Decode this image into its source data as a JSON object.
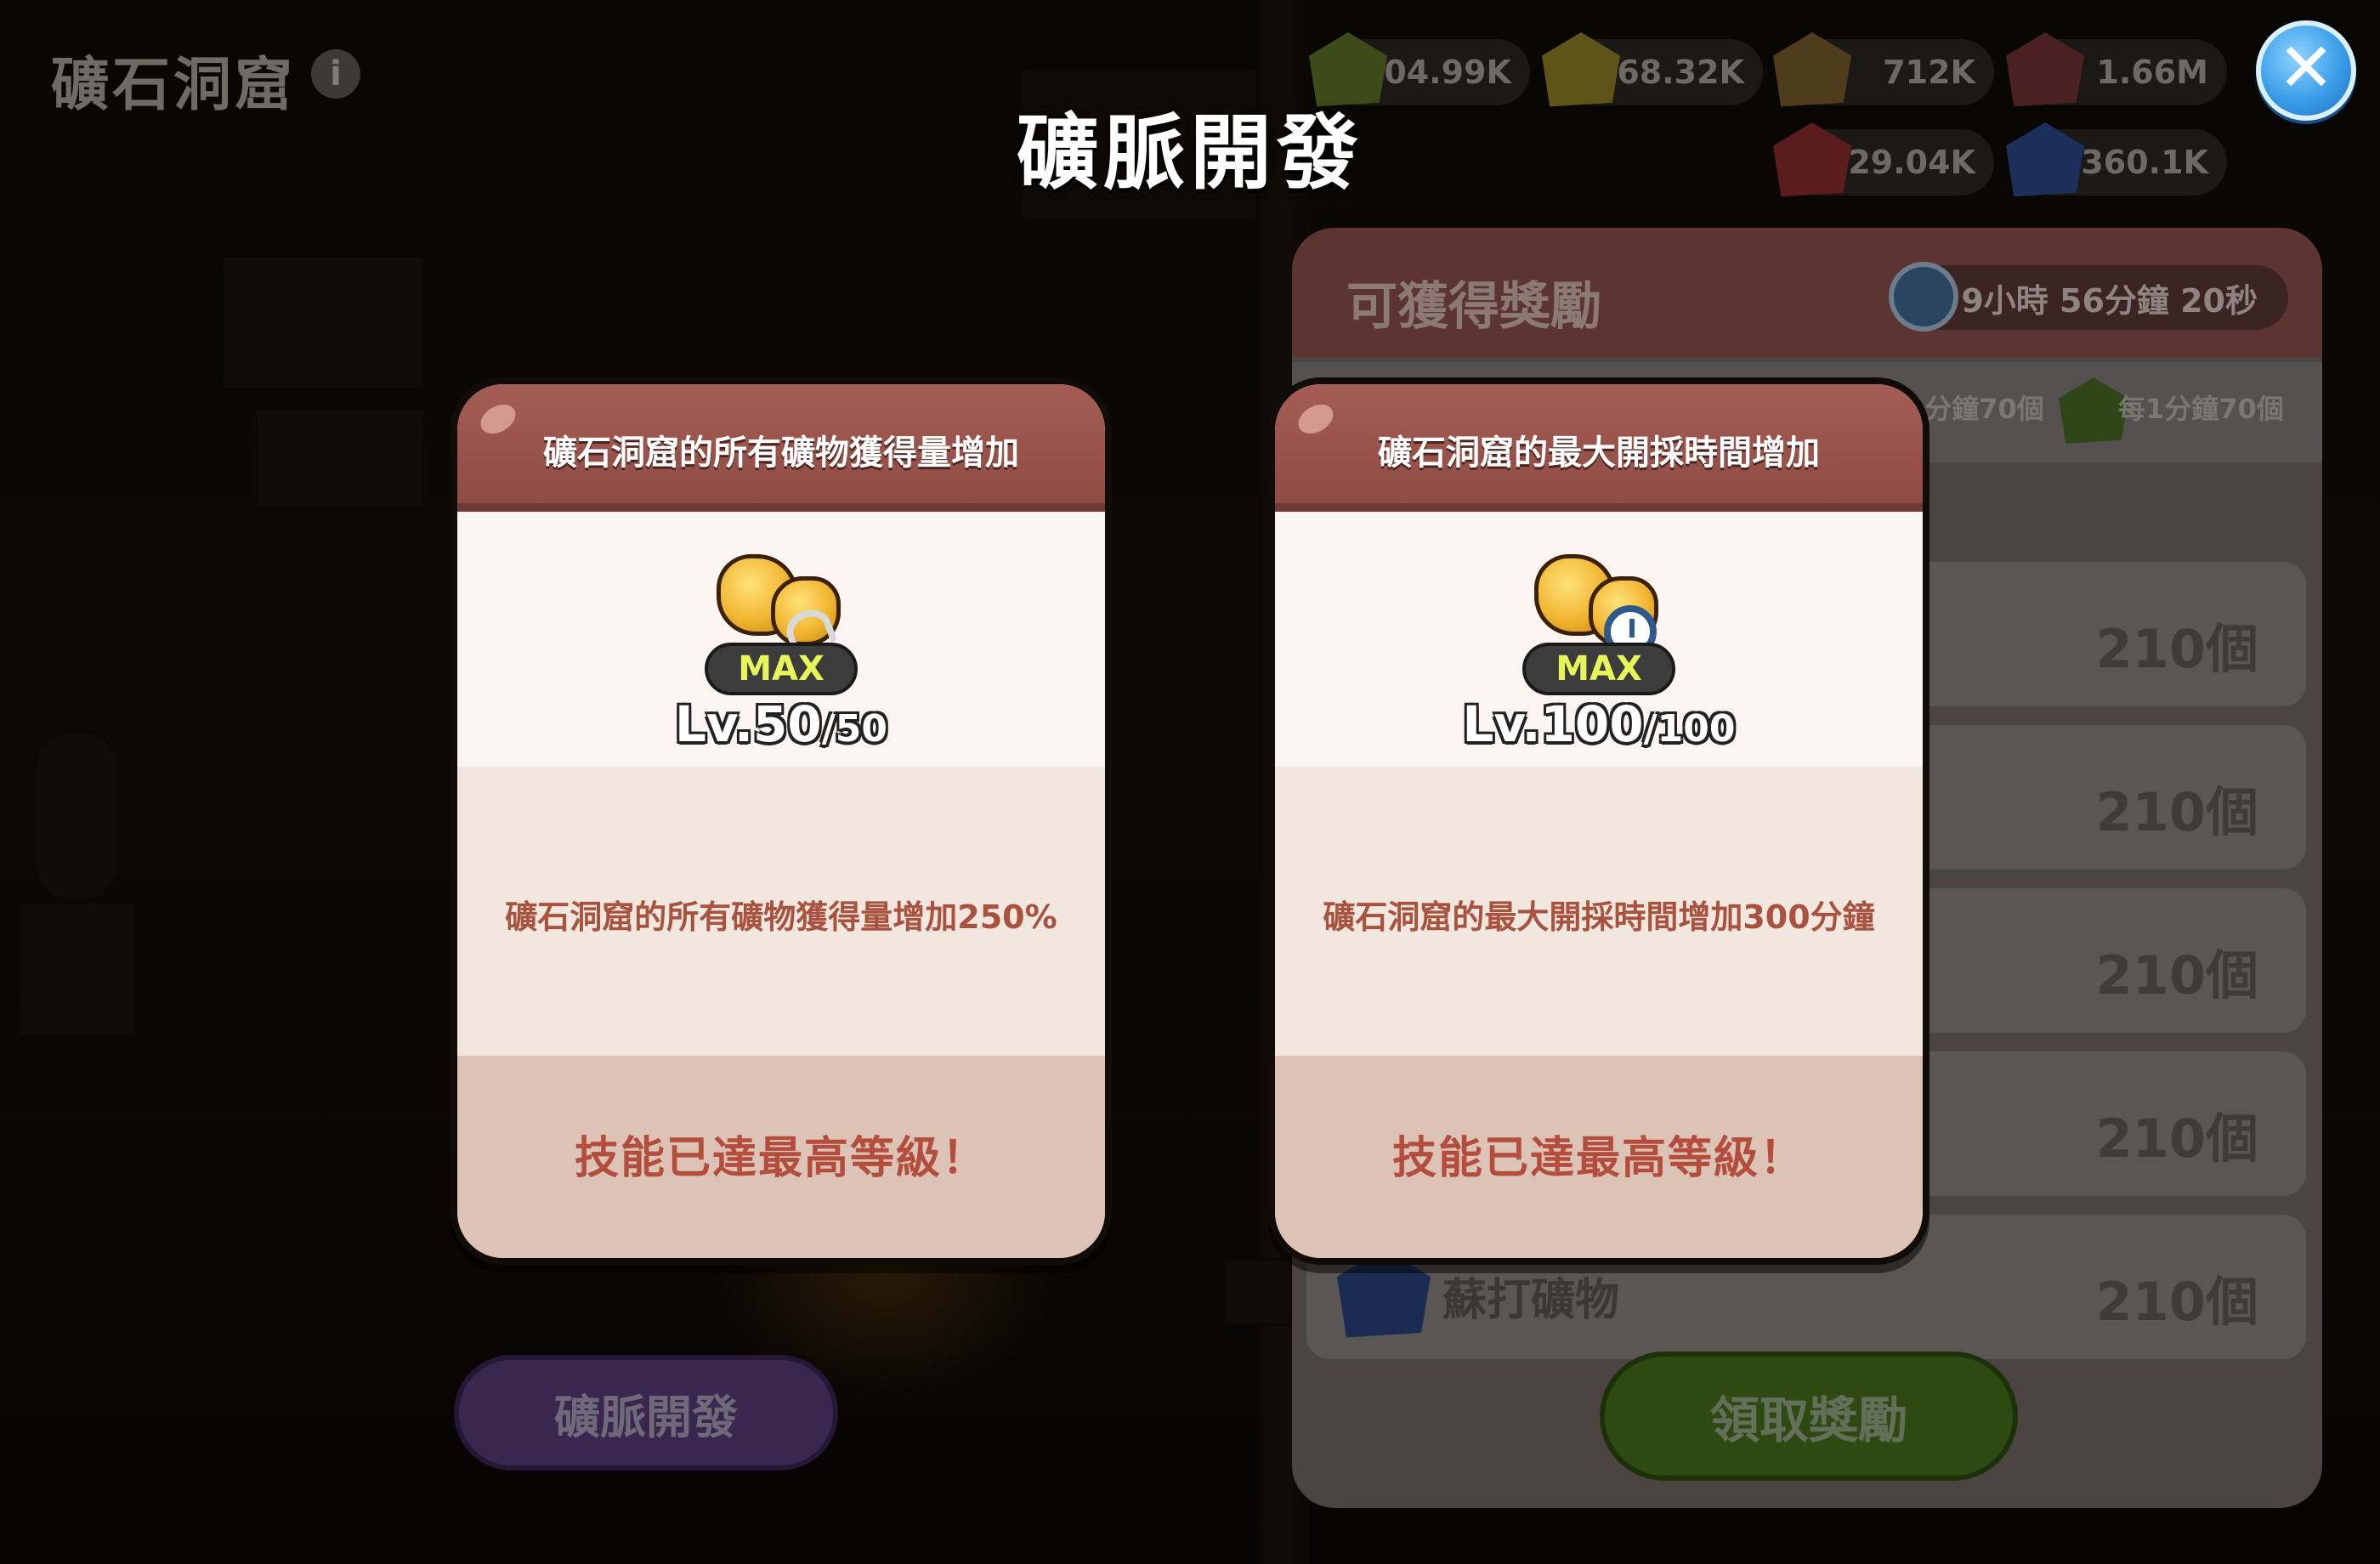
{
  "background": {
    "title": "礦石洞窟",
    "info_glyph": "i",
    "resources": [
      {
        "value": "404.99K",
        "color": "#3d4a1a"
      },
      {
        "value": "568.32K",
        "color": "#5e5418"
      },
      {
        "value": "712K",
        "color": "#4f3c1c"
      },
      {
        "value": "1.66M",
        "color": "#4a2020"
      },
      {
        "value": "29.04K",
        "color": "#5a1c1c"
      },
      {
        "value": "360.1K",
        "color": "#1c2f5a"
      }
    ],
    "reward_panel": {
      "title": "可獲得獎勵",
      "timer": "9小時 56分鐘 20秒",
      "rate_left": "1分鐘70個",
      "rate_right": "每1分鐘70個",
      "rows": [
        {
          "value": "210個",
          "name": ""
        },
        {
          "value": "210個",
          "name": ""
        },
        {
          "value": "210個",
          "name": ""
        },
        {
          "value": "210個",
          "name": ""
        },
        {
          "value": "210個",
          "name": "蘇打礦物"
        }
      ],
      "claim_button": "領取獎勵"
    },
    "develop_button": "礦脈開發"
  },
  "modal": {
    "title": "礦脈開發",
    "close_glyph": "✕",
    "cards": [
      {
        "header": "礦石洞窟的所有礦物獲得量增加",
        "icon": "gold-ore-pickaxe-icon",
        "badge": "MAX",
        "level_current": "Lv.50",
        "level_max": "/50",
        "description": "礦石洞窟的所有礦物獲得量增加250%",
        "status": "技能已達最高等級！"
      },
      {
        "header": "礦石洞窟的最大開採時間增加",
        "icon": "gold-ore-clock-icon",
        "badge": "MAX",
        "level_current": "Lv.100",
        "level_max": "/100",
        "description": "礦石洞窟的最大開採時間增加300分鐘",
        "status": "技能已達最高等級！"
      }
    ]
  },
  "colors": {
    "card_header": "#a35d54",
    "status_text": "#b34e3f",
    "close_button": "#3a9de8",
    "max_badge_text": "#e7f55a"
  }
}
